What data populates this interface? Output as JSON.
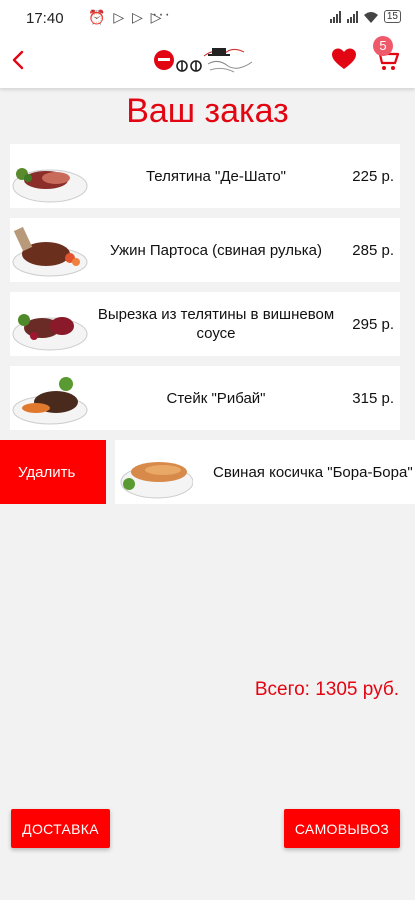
{
  "status_bar": {
    "time": "17:40",
    "left_icons": "⏰ ▷ ▷ ▷",
    "dots": "···",
    "battery": "15"
  },
  "app_bar": {
    "cart_count": "5"
  },
  "page": {
    "title": "Ваш заказ"
  },
  "order_items": [
    {
      "name": "Телятина \"Де-Шато\"",
      "price": "225 р."
    },
    {
      "name": "Ужин Партоса (свиная рулька)",
      "price": "285 р."
    },
    {
      "name": "Вырезка из телятины в вишневом соусе",
      "price": "295 р."
    },
    {
      "name": "Стейк \"Рибай\"",
      "price": "315 р."
    }
  ],
  "swiped_item": {
    "delete_label": "Удалить",
    "name": "Свиная косичка \"Бора-Бора\""
  },
  "total": {
    "label": "Всего: 1305 руб."
  },
  "actions": {
    "delivery": "ДОСТАВКА",
    "pickup": "САМОВЫВОЗ"
  },
  "colors": {
    "accent": "#e20613",
    "button": "#ff0000",
    "badge": "#ef5a6a"
  }
}
